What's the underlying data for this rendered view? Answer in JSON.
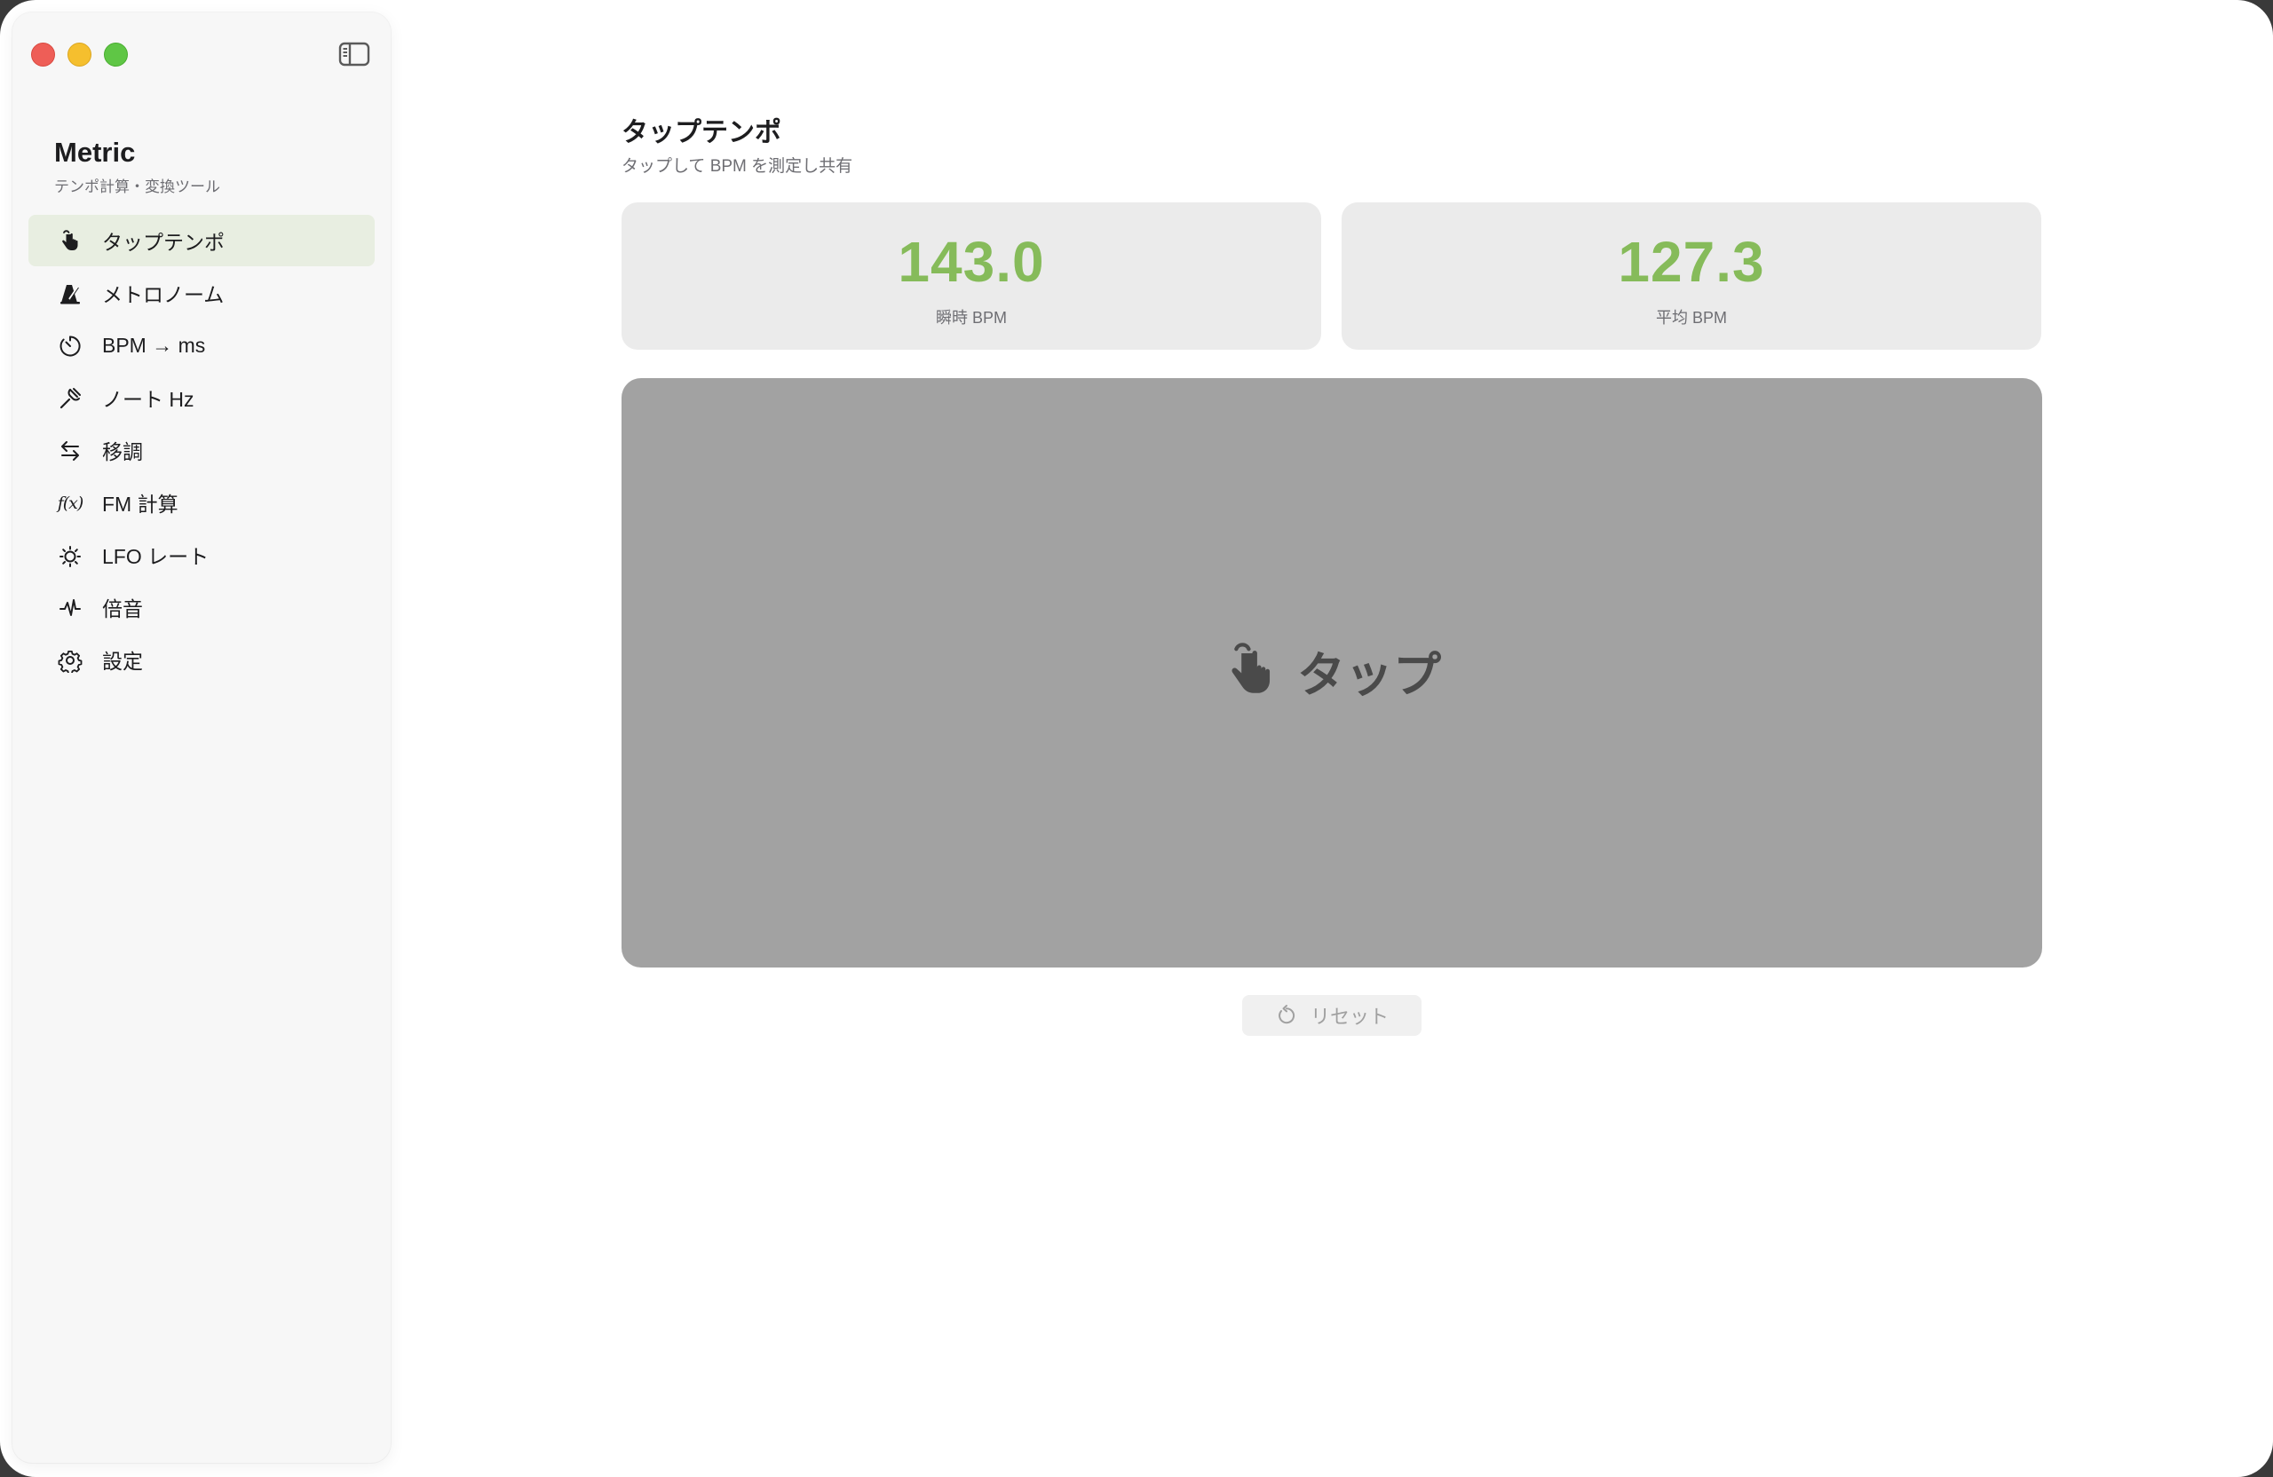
{
  "sidebar": {
    "app_title": "Metric",
    "app_subtitle": "テンポ計算・変換ツール",
    "items": [
      {
        "label": "タップテンポ",
        "icon": "hand-tap-icon",
        "active": true
      },
      {
        "label": "メトロノーム",
        "icon": "metronome-icon",
        "active": false
      },
      {
        "label": "BPM → ms",
        "icon": "timer-icon",
        "active": false
      },
      {
        "label": "ノート Hz",
        "icon": "tuning-fork-icon",
        "active": false
      },
      {
        "label": "移調",
        "icon": "transpose-arrows-icon",
        "active": false
      },
      {
        "label": "FM 計算",
        "icon": "function-icon",
        "active": false,
        "glyph": "f(x)"
      },
      {
        "label": "LFO レート",
        "icon": "lfo-sun-icon",
        "active": false
      },
      {
        "label": "倍音",
        "icon": "waveform-icon",
        "active": false
      },
      {
        "label": "設定",
        "icon": "gear-icon",
        "active": false
      }
    ]
  },
  "main": {
    "title": "タップテンポ",
    "subtitle": "タップして BPM を測定し共有",
    "instant": {
      "value": "143.0",
      "label": "瞬時 BPM"
    },
    "average": {
      "value": "127.3",
      "label": "平均 BPM"
    },
    "tap_pad": {
      "label": "タップ",
      "icon": "hand-tap-icon"
    },
    "reset": {
      "label": "リセット",
      "icon": "reset-arrow-icon"
    }
  },
  "colors": {
    "accent_green": "#86bb5a",
    "active_nav_bg": "#e8eee1",
    "tap_pad_bg": "#a2a2a2"
  }
}
